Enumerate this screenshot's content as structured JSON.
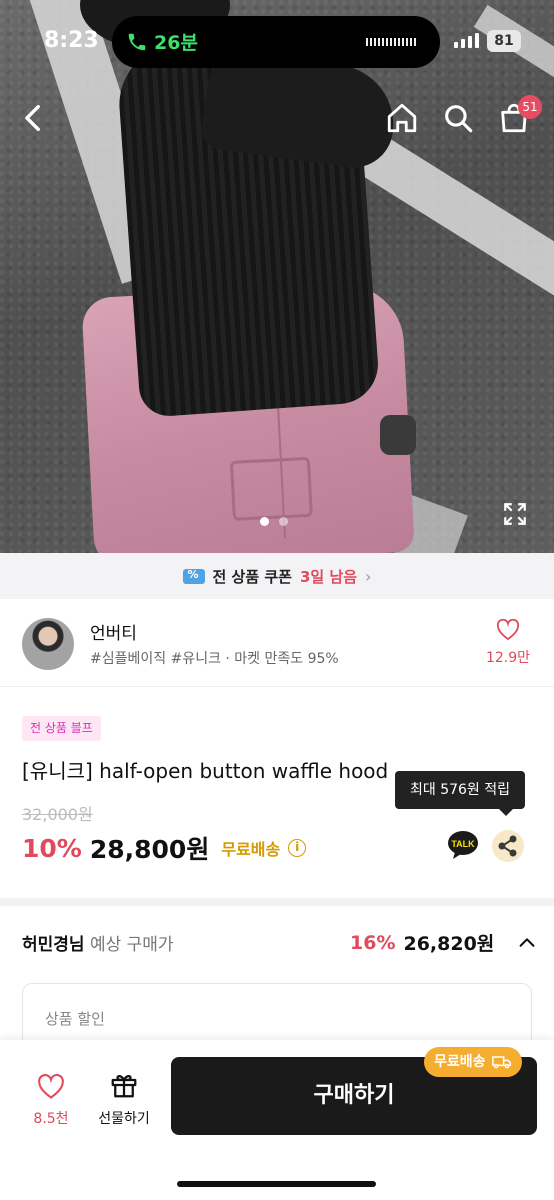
{
  "status": {
    "time": "8:23",
    "call": "26분",
    "battery": "81"
  },
  "header": {
    "cart_count": "51"
  },
  "hero": {
    "slide_count": 2,
    "active_slide": 1
  },
  "coupon": {
    "prefix": "전 상품 쿠폰",
    "highlight": "3일 남음",
    "chevron": "›"
  },
  "seller": {
    "name": "언버티",
    "tags": "#심플베이직 #유니크 · 마켓 만족도 95%",
    "likes": "12.9만"
  },
  "product": {
    "badge": "전 상품 블프",
    "title": "[유니크] half-open button waffle hood",
    "original_price": "32,000원",
    "discount": "10%",
    "price": "28,800원",
    "shipping": "무료배송",
    "info_icon": "i",
    "tooltip": "최대 576원 적립",
    "talk_label": "TALK"
  },
  "expected": {
    "user": "허민경님",
    "label": "예상 구매가",
    "discount": "16%",
    "price": "26,820원",
    "detail_label": "상품 할인"
  },
  "bottom": {
    "likes": "8.5천",
    "gift_label": "선물하기",
    "buy_label": "구매하기",
    "ship_tag": "무료배송"
  },
  "colors": {
    "accent_red": "#e04a5c",
    "shipping_gold": "#d59a00",
    "badge_pink": "#e02fb8",
    "buy_button": "#1a1a1a"
  }
}
